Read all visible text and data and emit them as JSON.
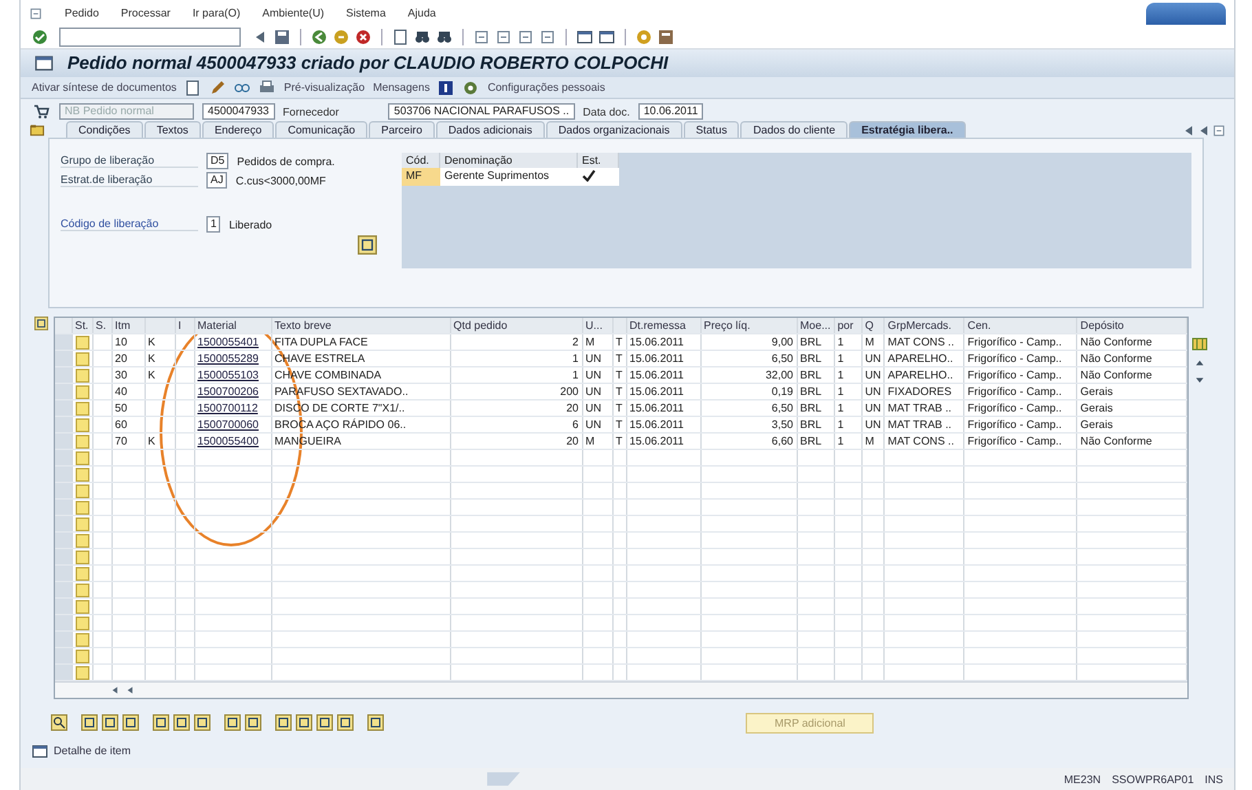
{
  "menu": [
    "Pedido",
    "Processar",
    "Ir para(O)",
    "Ambiente(U)",
    "Sistema",
    "Ajuda"
  ],
  "title": "Pedido normal 4500047933 criado por CLAUDIO ROBERTO COLPOCHI",
  "app_toolbar": [
    "Ativar síntese de documentos",
    "Pré-visualização",
    "Mensagens",
    "Configurações pessoais"
  ],
  "header": {
    "doc_type": "NB Pedido normal",
    "doc_number": "4500047933",
    "supplier_label": "Fornecedor",
    "supplier": "503706 NACIONAL PARAFUSOS ..",
    "date_label": "Data doc.",
    "date": "10.06.2011"
  },
  "tabs": [
    {
      "label": "Condições",
      "selected": false
    },
    {
      "label": "Textos",
      "selected": false
    },
    {
      "label": "Endereço",
      "selected": false
    },
    {
      "label": "Comunicação",
      "selected": false
    },
    {
      "label": "Parceiro",
      "selected": false
    },
    {
      "label": "Dados adicionais",
      "selected": false
    },
    {
      "label": "Dados organizacionais",
      "selected": false
    },
    {
      "label": "Status",
      "selected": false
    },
    {
      "label": "Dados do cliente",
      "selected": false
    },
    {
      "label": "Estratégia libera..",
      "selected": true
    }
  ],
  "release": {
    "fields": [
      {
        "label": "Grupo de liberação",
        "code": "D5",
        "text": "Pedidos de compra."
      },
      {
        "label": "Estrat.de liberação",
        "code": "AJ",
        "text": "C.cus<3000,00MF"
      },
      {
        "label": "Código de liberação",
        "code": "1",
        "text": "Liberado"
      }
    ],
    "columns": [
      "Cód.",
      "Denominação",
      "Est."
    ],
    "rows": [
      {
        "code": "MF",
        "name": "Gerente Suprimentos",
        "released": true
      }
    ]
  },
  "items": {
    "columns": [
      "St.",
      "S.",
      "Itm",
      "I",
      "Material",
      "Texto breve",
      "Qtd pedido",
      "U...",
      "Dt.remessa",
      "Preço líq.",
      "Moe...",
      "por",
      "Q",
      "GrpMercads.",
      "Cen.",
      "Depósito"
    ],
    "rows": [
      {
        "itm": "10",
        "k": "K",
        "material": "1500055401",
        "text": "FITA DUPLA FACE",
        "qty": "2",
        "unit": "M",
        "t": "T",
        "date": "15.06.2011",
        "price": "9,00",
        "cur": "BRL",
        "per": "1",
        "q": "M",
        "group": "MAT CONS ..",
        "plant": "Frigorífico - Camp..",
        "store": "Não Conforme"
      },
      {
        "itm": "20",
        "k": "K",
        "material": "1500055289",
        "text": "CHAVE ESTRELA",
        "qty": "1",
        "unit": "UN",
        "t": "T",
        "date": "15.06.2011",
        "price": "6,50",
        "cur": "BRL",
        "per": "1",
        "q": "UN",
        "group": "APARELHO..",
        "plant": "Frigorífico - Camp..",
        "store": "Não Conforme"
      },
      {
        "itm": "30",
        "k": "K",
        "material": "1500055103",
        "text": "CHAVE COMBINADA",
        "qty": "1",
        "unit": "UN",
        "t": "T",
        "date": "15.06.2011",
        "price": "32,00",
        "cur": "BRL",
        "per": "1",
        "q": "UN",
        "group": "APARELHO..",
        "plant": "Frigorífico - Camp..",
        "store": "Não Conforme"
      },
      {
        "itm": "40",
        "material": "1500700206",
        "text": "PARAFUSO SEXTAVADO..",
        "qty": "200",
        "unit": "UN",
        "t": "T",
        "date": "15.06.2011",
        "price": "0,19",
        "cur": "BRL",
        "per": "1",
        "q": "UN",
        "group": "FIXADORES",
        "plant": "Frigorífico - Camp..",
        "store": "Gerais"
      },
      {
        "itm": "50",
        "material": "1500700112",
        "text": "DISCO DE CORTE 7\"X1/..",
        "qty": "20",
        "unit": "UN",
        "t": "T",
        "date": "15.06.2011",
        "price": "6,50",
        "cur": "BRL",
        "per": "1",
        "q": "UN",
        "group": "MAT TRAB ..",
        "plant": "Frigorífico - Camp..",
        "store": "Gerais"
      },
      {
        "itm": "60",
        "material": "1500700060",
        "text": "BROCA AÇO RÁPIDO 06..",
        "qty": "6",
        "unit": "UN",
        "t": "T",
        "date": "15.06.2011",
        "price": "3,50",
        "cur": "BRL",
        "per": "1",
        "q": "UN",
        "group": "MAT TRAB ..",
        "plant": "Frigorífico - Camp..",
        "store": "Gerais"
      },
      {
        "itm": "70",
        "k": "K",
        "material": "1500055400",
        "text": "MANGUEIRA",
        "qty": "20",
        "unit": "M",
        "t": "T",
        "date": "15.06.2011",
        "price": "6,60",
        "cur": "BRL",
        "per": "1",
        "q": "M",
        "group": "MAT CONS ..",
        "plant": "Frigorífico - Camp..",
        "store": "Não Conforme"
      }
    ]
  },
  "mrp_button": "MRP adicional",
  "item_detail": "Detalhe de item",
  "status_bar": {
    "transaction": "ME23N",
    "server": "SSOWPR6AP01",
    "mode": "INS"
  }
}
